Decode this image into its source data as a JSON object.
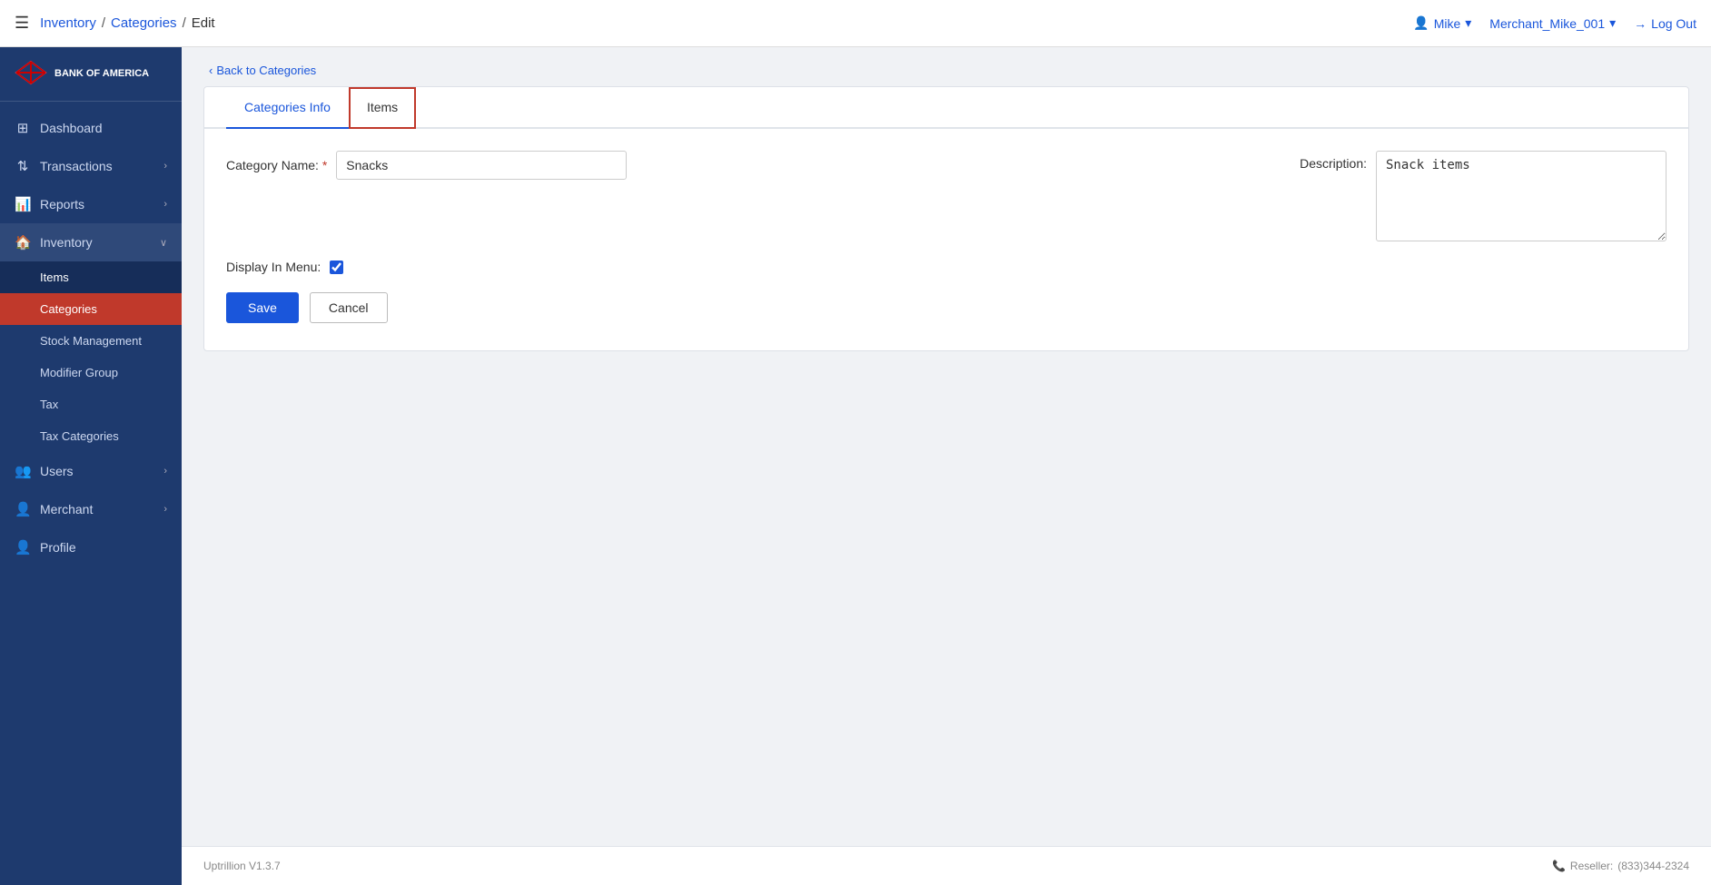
{
  "header": {
    "hamburger": "☰",
    "breadcrumb": {
      "inventory": "Inventory",
      "sep1": "/",
      "categories": "Categories",
      "sep2": "/",
      "current": "Edit"
    },
    "user_label": "Mike",
    "merchant_label": "Merchant_Mike_001",
    "logout_label": "Log Out",
    "logout_icon": "→"
  },
  "sidebar": {
    "logo_line1": "BANK OF AMERICA",
    "version_footer": "Uptrillion V1.3.7",
    "items": [
      {
        "id": "dashboard",
        "label": "Dashboard",
        "icon": "⊞",
        "has_arrow": false
      },
      {
        "id": "transactions",
        "label": "Transactions",
        "icon": "↕",
        "has_arrow": true
      },
      {
        "id": "reports",
        "label": "Reports",
        "icon": "📋",
        "has_arrow": true
      },
      {
        "id": "inventory",
        "label": "Inventory",
        "icon": "🏠",
        "has_arrow": true,
        "active_parent": true
      },
      {
        "id": "users",
        "label": "Users",
        "icon": "👥",
        "has_arrow": true
      },
      {
        "id": "merchant",
        "label": "Merchant",
        "icon": "👤",
        "has_arrow": true
      },
      {
        "id": "profile",
        "label": "Profile",
        "icon": "👤",
        "has_arrow": false
      }
    ],
    "inventory_sub": [
      {
        "id": "items",
        "label": "Items",
        "active": false
      },
      {
        "id": "categories",
        "label": "Categories",
        "active": true
      },
      {
        "id": "stock_management",
        "label": "Stock Management",
        "active": false
      },
      {
        "id": "modifier_group",
        "label": "Modifier Group",
        "active": false
      },
      {
        "id": "tax",
        "label": "Tax",
        "active": false
      },
      {
        "id": "tax_categories",
        "label": "Tax Categories",
        "active": false
      }
    ]
  },
  "back_link": "Back to Categories",
  "tabs": [
    {
      "id": "categories_info",
      "label": "Categories Info",
      "active": true,
      "highlighted": false
    },
    {
      "id": "items",
      "label": "Items",
      "active": false,
      "highlighted": true
    }
  ],
  "form": {
    "category_name_label": "Category Name:",
    "category_name_required": "*",
    "category_name_value": "Snacks",
    "display_in_menu_label": "Display In Menu:",
    "display_in_menu_checked": true,
    "description_label": "Description:",
    "description_value": "Snack items",
    "save_label": "Save",
    "cancel_label": "Cancel"
  },
  "footer": {
    "version": "Uptrillion V1.3.7",
    "reseller_label": "Reseller:",
    "phone": "(833)344-2324",
    "phone_icon": "📞"
  }
}
